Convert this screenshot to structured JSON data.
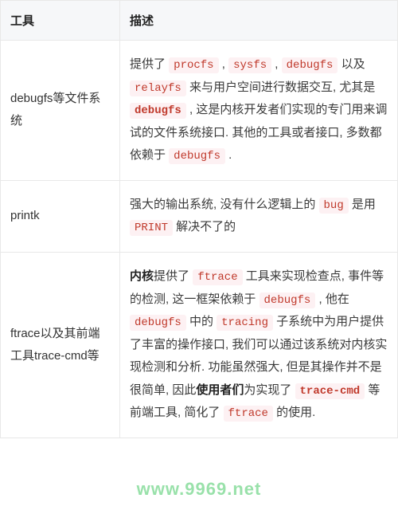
{
  "table": {
    "headers": {
      "tool": "工具",
      "desc": "描述"
    },
    "rows": [
      {
        "tool": "debugfs等文件系统",
        "desc": {
          "t0": "提供了 ",
          "c0": "procfs",
          "t1": " , ",
          "c1": "sysfs",
          "t2": " , ",
          "c2": "debugfs",
          "t3": " 以及 ",
          "c3": "relayfs",
          "t4": " 来与用户空间进行数据交互, 尤其是 ",
          "c4": "debugfs",
          "t5": " , 这是内核开发者们实现的专门用来调试的文件系统接口. 其他的工具或者接口, 多数都依赖于 ",
          "c5": "debugfs",
          "t6": " ."
        }
      },
      {
        "tool": "printk",
        "desc": {
          "t0": "强大的输出系统, 没有什么逻辑上的 ",
          "c0": "bug",
          "t1": " 是用 ",
          "c1": "PRINT",
          "t2": " 解决不了的"
        }
      },
      {
        "tool": "ftrace以及其前端工具trace-cmd等",
        "desc": {
          "s0": "内核",
          "t0": "提供了 ",
          "c0": "ftrace",
          "t1": " 工具来实现检查点, 事件等的检测, 这一框架依赖于 ",
          "c1": "debugfs",
          "t2": " , 他在 ",
          "c2": "debugfs",
          "t3": " 中的 ",
          "c3": "tracing",
          "t4": " 子系统中为用户提供了丰富的操作接口, 我们可以通过该系统对内核实现检测和分析. 功能虽然强大, 但是其操作并不是很简单, 因此",
          "s1": "使用者们",
          "t5": "为实现了 ",
          "c4": "trace-cmd",
          "t6": " 等前端工具, 简化了 ",
          "c5": "ftrace",
          "t7": " 的使用."
        }
      }
    ]
  },
  "watermark": "www.9969.net"
}
